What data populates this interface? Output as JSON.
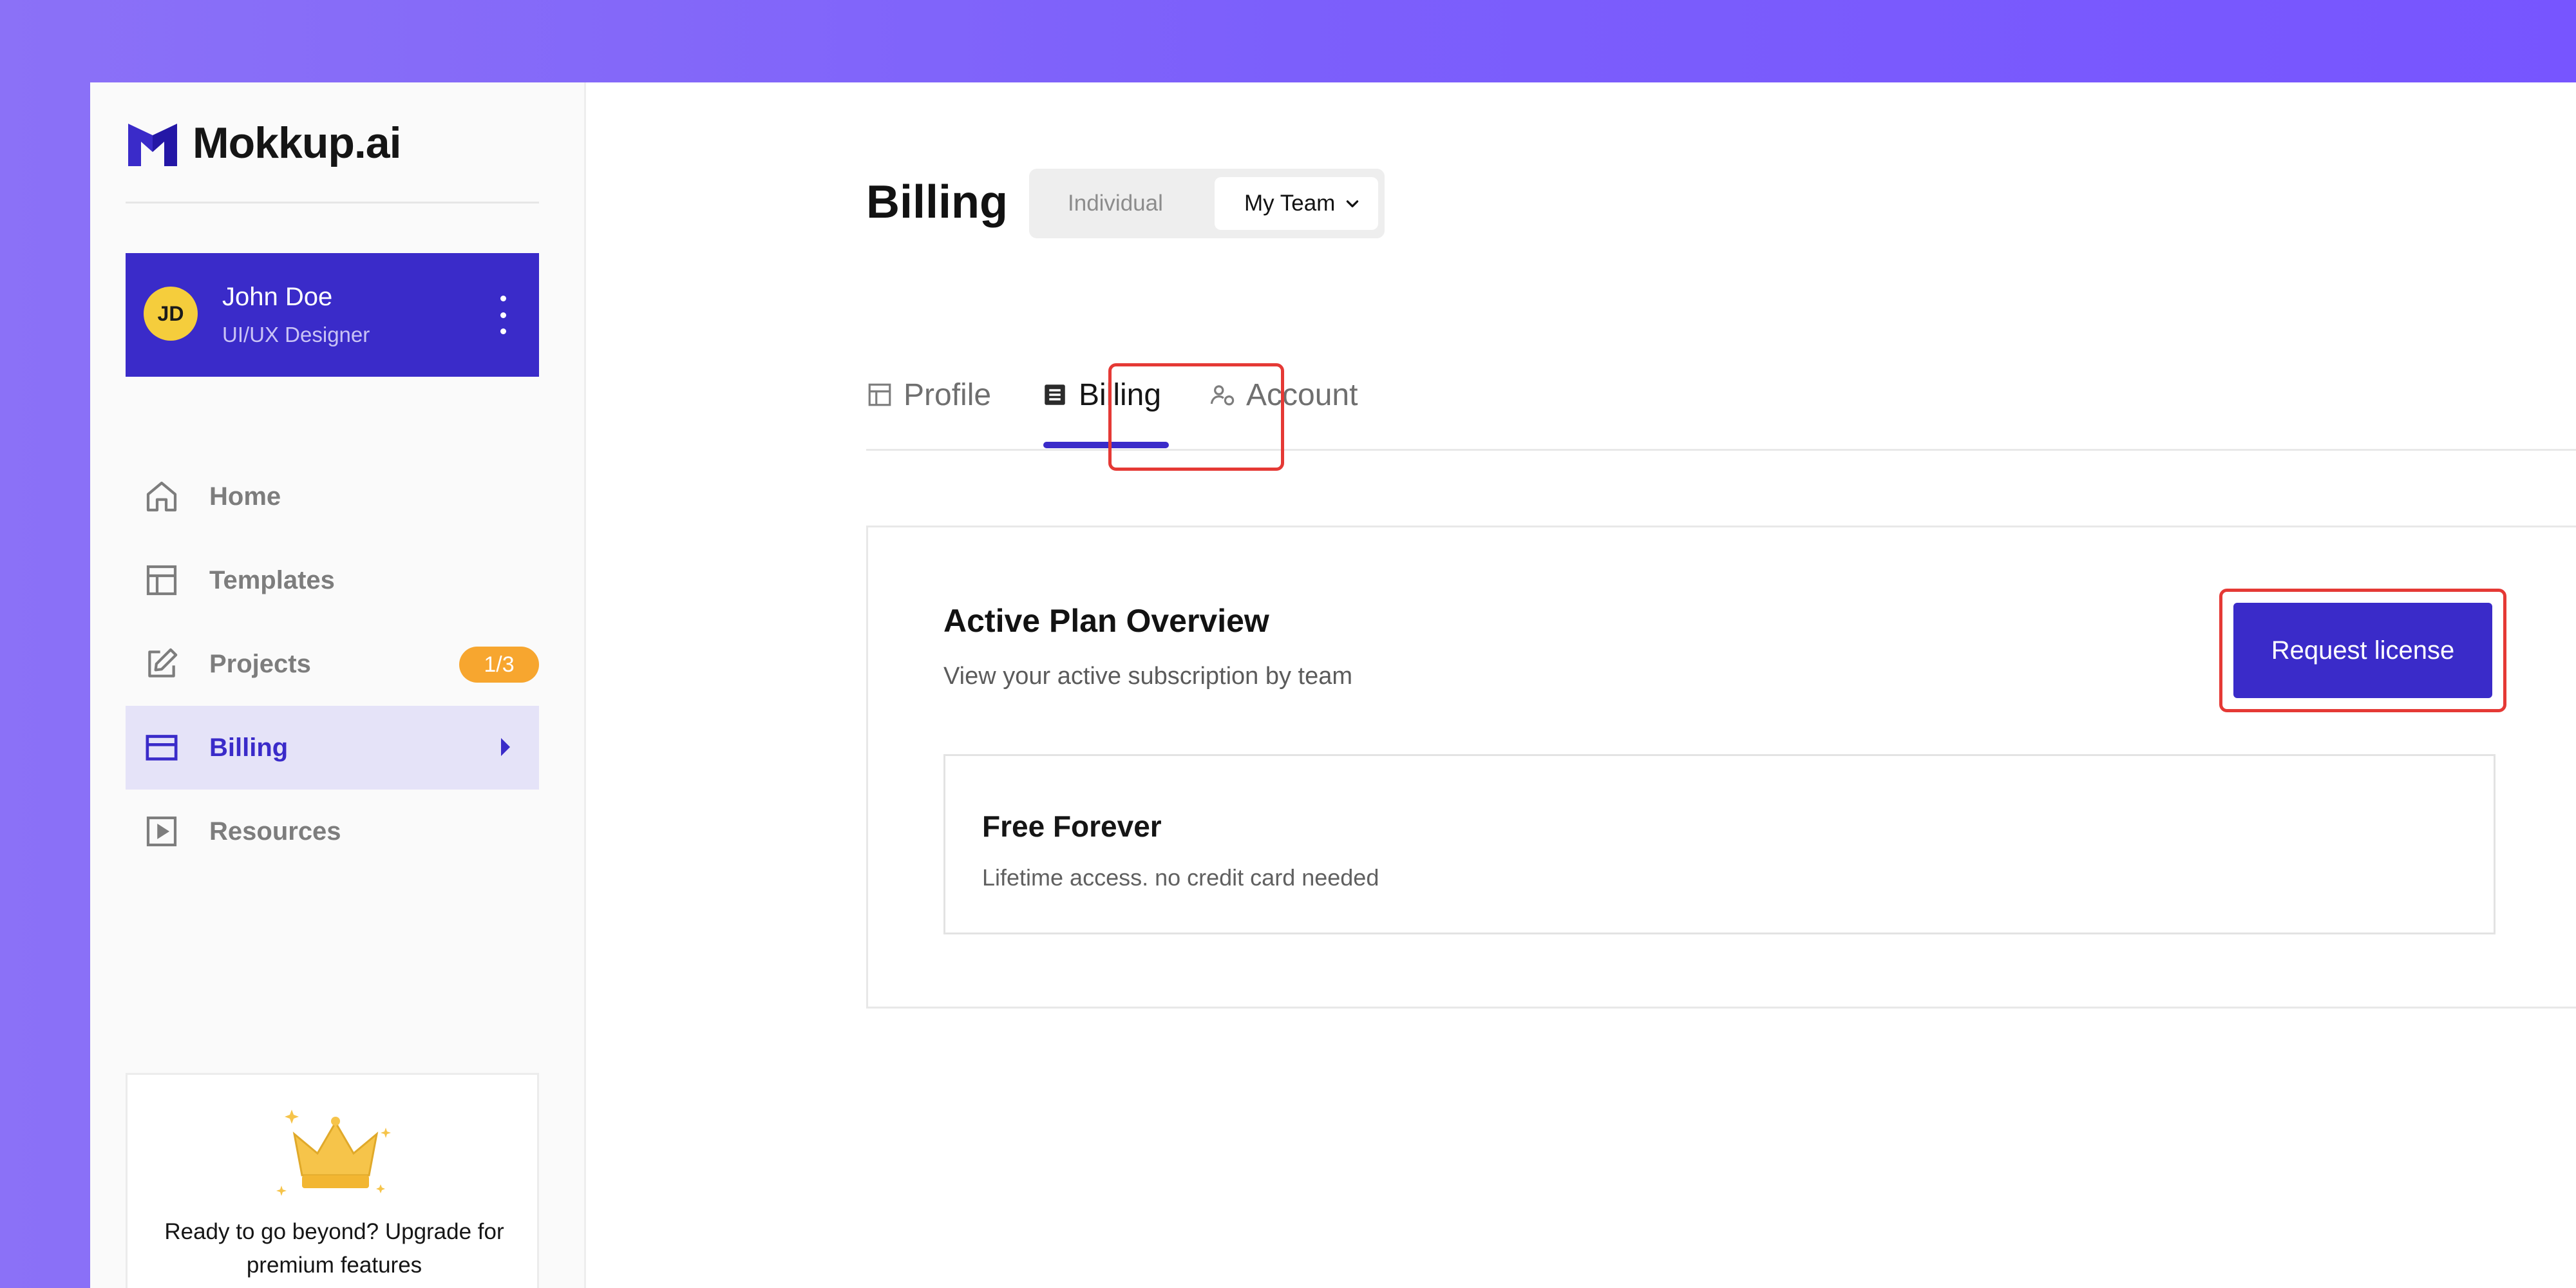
{
  "brand": {
    "name": "Mokkup.ai",
    "color": "#3a2bc9"
  },
  "user": {
    "initials": "JD",
    "name": "John Doe",
    "role": "UI/UX Designer"
  },
  "sidebar": {
    "items": [
      {
        "label": "Home",
        "icon": "home-icon"
      },
      {
        "label": "Templates",
        "icon": "layout-icon"
      },
      {
        "label": "Projects",
        "icon": "edit-icon",
        "badge": "1/3"
      },
      {
        "label": "Billing",
        "icon": "credit-card-icon",
        "active": true
      },
      {
        "label": "Resources",
        "icon": "play-box-icon"
      }
    ]
  },
  "upgrade": {
    "text": "Ready to go beyond? Upgrade for premium features",
    "icon": "crown-icon"
  },
  "main": {
    "title": "Billing",
    "toggle": {
      "individual": "Individual",
      "team": "My Team"
    },
    "tabs": [
      {
        "label": "Profile",
        "icon": "layout-icon"
      },
      {
        "label": "Billing",
        "icon": "document-icon",
        "active": true
      },
      {
        "label": "Account",
        "icon": "users-icon"
      }
    ],
    "plan_card": {
      "title": "Active Plan Overview",
      "subtitle": "View your active subscription by team",
      "button": "Request license",
      "plan": {
        "name": "Free Forever",
        "description": "Lifetime access. no credit card needed"
      }
    }
  },
  "colors": {
    "accent": "#3a2bc9",
    "badge": "#f7a62f",
    "highlight": "#e53935",
    "avatar": "#f5cd3c"
  }
}
